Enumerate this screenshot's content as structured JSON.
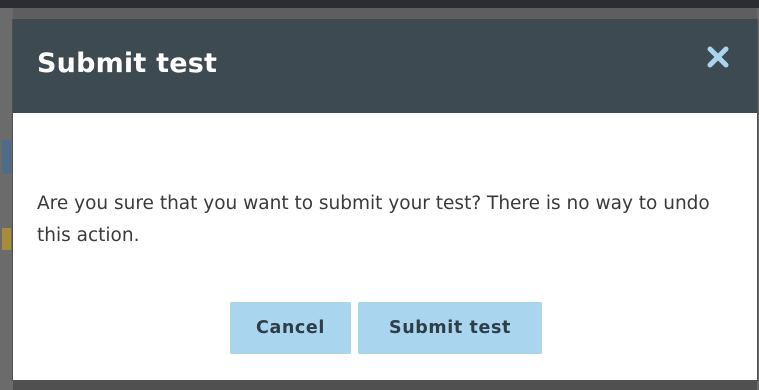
{
  "dialog": {
    "title": "Submit test",
    "message": "Are you sure that you want to submit your test? There is no way to undo this action.",
    "close_icon": "close-icon",
    "buttons": {
      "cancel_label": "Cancel",
      "submit_label": "Submit test"
    }
  },
  "colors": {
    "header_bg": "#3e4a52",
    "button_bg": "#a9d6ee",
    "button_text": "#2e3e48",
    "body_text": "#3a3a3a",
    "close_icon": "#a9d6ee"
  }
}
